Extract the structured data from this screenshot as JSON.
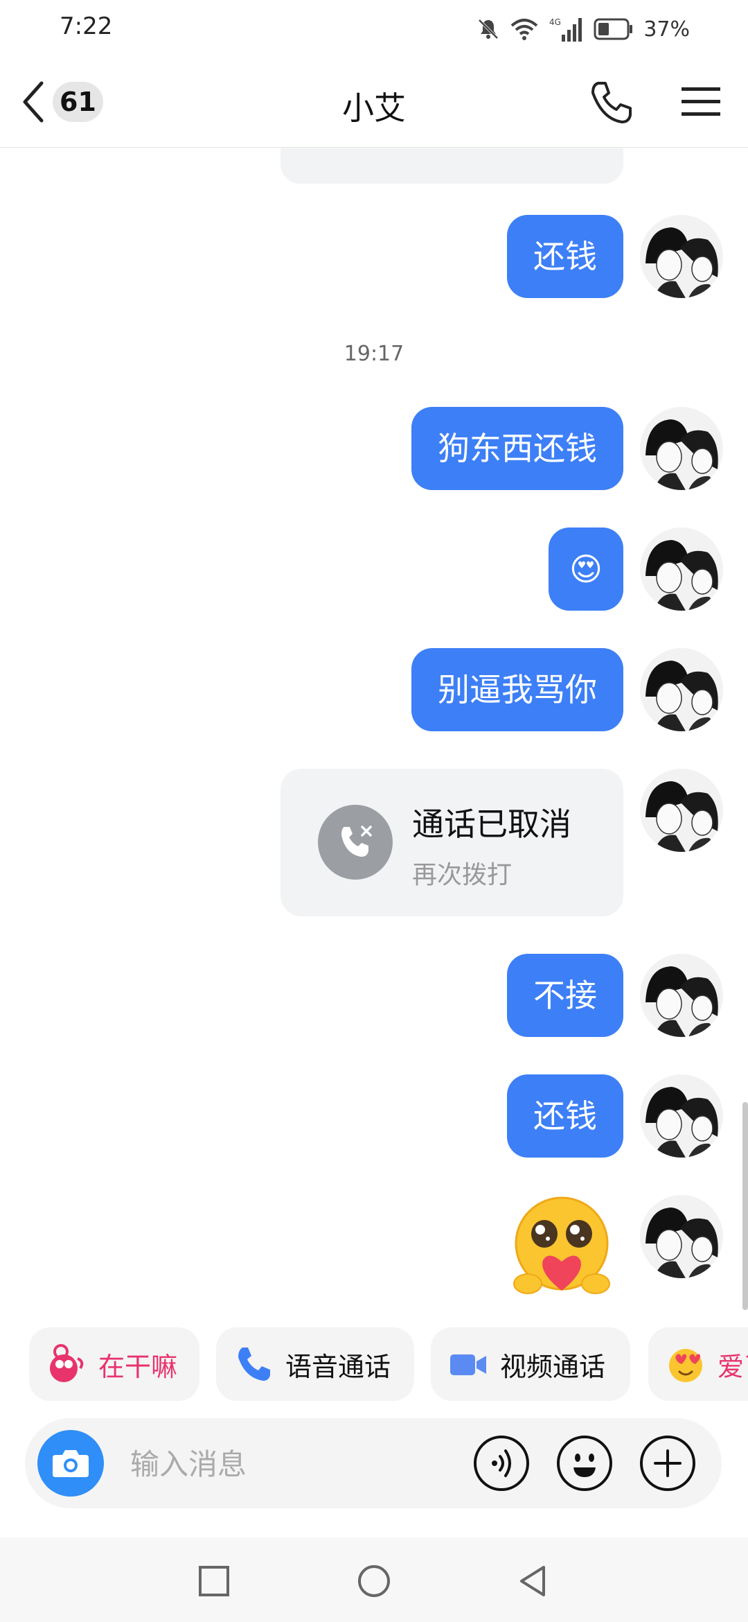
{
  "status_bar": {
    "time": "7:22",
    "battery_text": "37%",
    "network": "4G"
  },
  "header": {
    "unread_count": "61",
    "title": "小艾"
  },
  "messages": {
    "m1": "还钱",
    "timestamp": "19:17",
    "m2": "狗东西还钱",
    "m3": "😍",
    "m4": "别逼我骂你",
    "call_card": {
      "title": "通话已取消",
      "subtitle": "再次拨打"
    },
    "m5": "不接",
    "m6": "还钱"
  },
  "quick_actions": [
    {
      "label": "在干嘛",
      "icon": "sticker-icon",
      "color": "#e8336d"
    },
    {
      "label": "语音通话",
      "icon": "phone-icon",
      "color": "#3d7ff6"
    },
    {
      "label": "视频通话",
      "icon": "video-camera-icon",
      "color": "#5b8bf2"
    },
    {
      "label": "爱了",
      "icon": "heart-eyes-icon",
      "color": "#e8336d"
    }
  ],
  "input": {
    "placeholder": "输入消息"
  },
  "colors": {
    "sent_bubble": "#3d7ff6",
    "camera_button": "#2f8ef7",
    "card_bg": "#f2f3f5"
  }
}
